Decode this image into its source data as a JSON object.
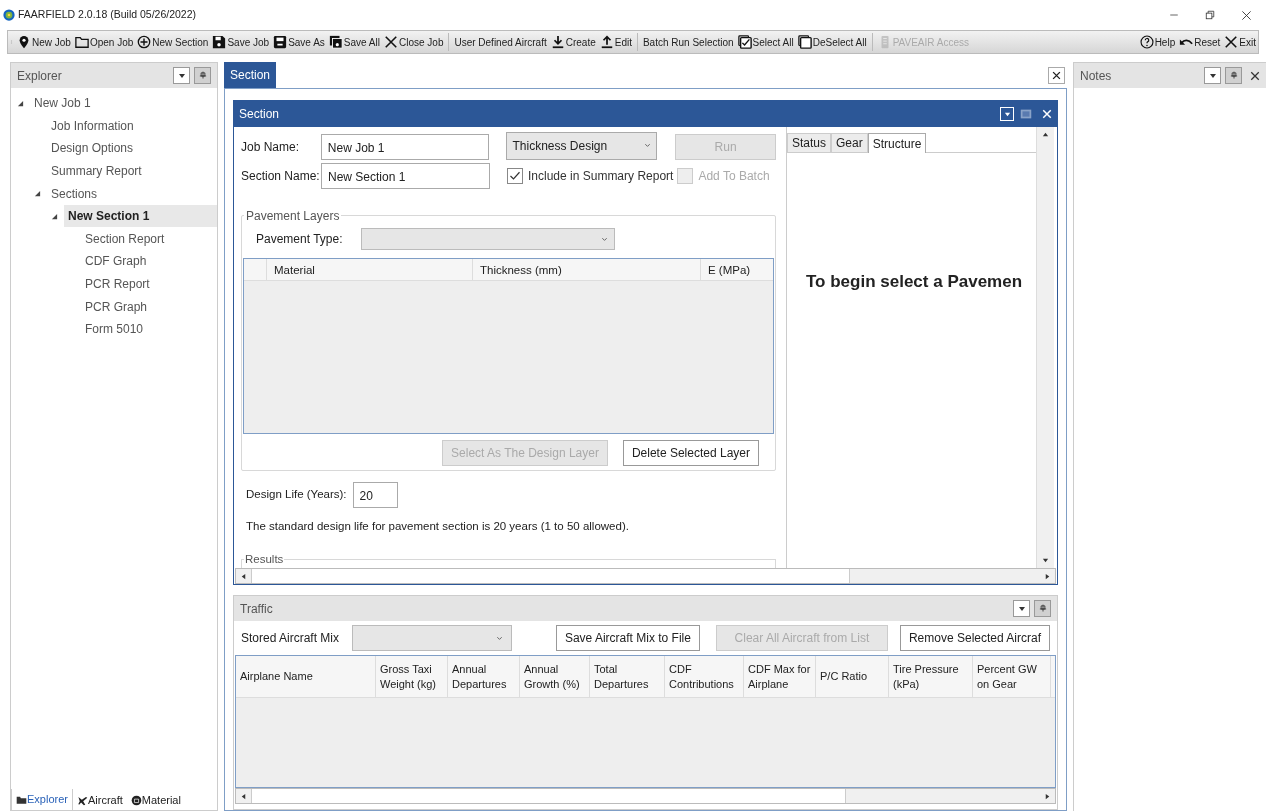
{
  "window": {
    "title": "FAARFIELD 2.0.18 (Build 05/26/2022)"
  },
  "toolbar": {
    "left": [
      {
        "label": "New Job",
        "disabled": false
      },
      {
        "label": "Open Job",
        "disabled": false
      },
      {
        "label": "New Section",
        "disabled": false
      },
      {
        "label": "Save Job",
        "disabled": false
      },
      {
        "label": "Save As",
        "disabled": false
      },
      {
        "label": "Save All",
        "disabled": false
      },
      {
        "label": "Close Job",
        "disabled": false
      },
      {
        "label": "User Defined Aircraft",
        "disabled": false
      },
      {
        "label": "Create",
        "disabled": false
      },
      {
        "label": "Edit",
        "disabled": false
      },
      {
        "label": "Batch Run Selection",
        "disabled": false
      },
      {
        "label": "Select All",
        "disabled": false
      },
      {
        "label": "DeSelect All",
        "disabled": false
      },
      {
        "label": "PAVEAIR Access",
        "disabled": true
      }
    ],
    "right": [
      {
        "label": "Help"
      },
      {
        "label": "Reset"
      },
      {
        "label": "Exit"
      }
    ]
  },
  "explorer": {
    "title": "Explorer",
    "tree": [
      {
        "label": "New Job 1",
        "expanded": true,
        "selected": false,
        "children": [
          {
            "label": "Job Information",
            "selected": false
          },
          {
            "label": "Design Options",
            "selected": false
          },
          {
            "label": "Summary Report",
            "selected": false
          },
          {
            "label": "Sections",
            "expanded": true,
            "selected": false,
            "children": [
              {
                "label": "New Section 1",
                "expanded": true,
                "selected": true,
                "children": [
                  {
                    "label": "Section Report",
                    "selected": false
                  },
                  {
                    "label": "CDF Graph",
                    "selected": false
                  },
                  {
                    "label": "PCR Report",
                    "selected": false
                  },
                  {
                    "label": "PCR Graph",
                    "selected": false
                  },
                  {
                    "label": "Form 5010",
                    "selected": false
                  }
                ]
              }
            ]
          }
        ]
      }
    ],
    "tabs": [
      {
        "label": "Explorer",
        "selected": true
      },
      {
        "label": "Aircraft",
        "selected": false
      },
      {
        "label": "Material",
        "selected": false
      }
    ]
  },
  "document_tabs": [
    {
      "label": "Section",
      "selected": true
    }
  ],
  "section": {
    "title": "Section",
    "job_name": {
      "label": "Job Name:",
      "value": "New Job 1"
    },
    "section_name": {
      "label": "Section Name:",
      "value": "New Section 1"
    },
    "design_mode": "Thickness Design",
    "run_button": {
      "label": "Run",
      "disabled": true
    },
    "include_in_summary": {
      "label": "Include in Summary Report",
      "checked": true
    },
    "add_to_batch": {
      "label": "Add To Batch",
      "checked": false,
      "disabled": true
    },
    "pavement_layers": {
      "title": "Pavement Layers",
      "type_label": "Pavement Type:",
      "columns": [
        "Material",
        "Thickness (mm)",
        "E (MPa)"
      ],
      "buttons": [
        {
          "label": "Select As The Design Layer",
          "disabled": true
        },
        {
          "label": "Delete Selected Layer",
          "disabled": false
        }
      ]
    },
    "design_life": {
      "label": "Design Life (Years):",
      "value": "20"
    },
    "design_life_note": "The standard design life for pavement section is 20 years (1 to 50 allowed).",
    "results_title": "Results",
    "side_tabs": [
      {
        "label": "Status",
        "selected": false
      },
      {
        "label": "Gear",
        "selected": false
      },
      {
        "label": "Structure",
        "selected": true
      }
    ],
    "side_message": "To begin select a Pavemen"
  },
  "traffic": {
    "title": "Traffic",
    "stored_mix_label": "Stored Aircraft Mix",
    "buttons": [
      {
        "label": "Save Aircraft Mix to File",
        "disabled": false
      },
      {
        "label": "Clear All Aircraft from List",
        "disabled": true
      },
      {
        "label": "Remove Selected Aircraf",
        "disabled": false
      }
    ],
    "columns": [
      "Airplane Name",
      "Gross Taxi Weight (kg)",
      "Annual Departures",
      "Annual Growth (%)",
      "Total Departures",
      "CDF Contributions",
      "CDF Max for Airplane",
      "P/C Ratio",
      "Tire Pressure (kPa)",
      "Percent GW on Gear"
    ]
  },
  "notes": {
    "title": "Notes"
  }
}
